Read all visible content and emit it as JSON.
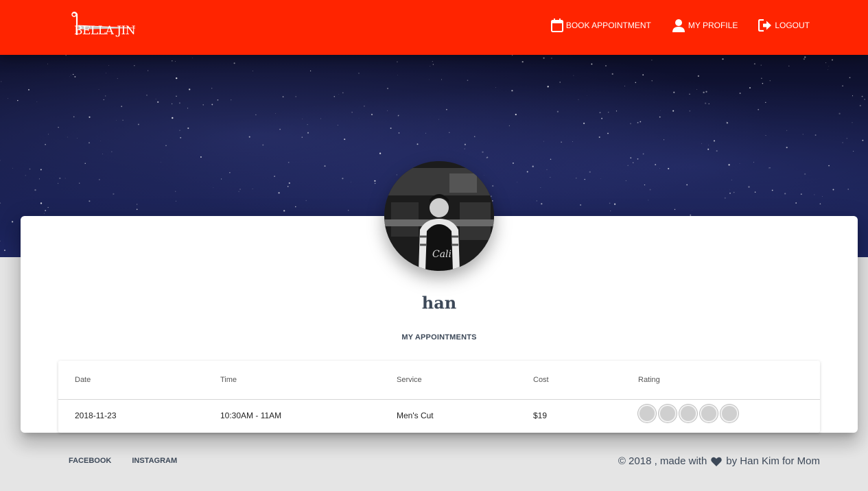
{
  "brand": {
    "logo_text": "BELLA JIN"
  },
  "nav": {
    "book": {
      "label": "BOOK APPOINTMENT",
      "icon": "calendar-icon"
    },
    "profile": {
      "label": "MY PROFILE",
      "icon": "user-icon"
    },
    "logout": {
      "label": "LOGOUT",
      "icon": "logout-icon"
    }
  },
  "profile": {
    "username": "han",
    "section_title": "MY APPOINTMENTS"
  },
  "table": {
    "headers": [
      "Date",
      "Time",
      "Service",
      "Cost",
      "Rating"
    ],
    "rows": [
      {
        "date": "2018-11-23",
        "time": "10:30AM - 11AM",
        "service": "Men's Cut",
        "cost": "$19",
        "rating": 0,
        "rating_max": 5
      }
    ]
  },
  "footer": {
    "links": [
      "FACEBOOK",
      "INSTAGRAM"
    ],
    "copyright_prefix": "© 2018 , made with",
    "copyright_suffix": "by Han Kim for Mom"
  },
  "colors": {
    "navbar": "#ff2400",
    "text": "#3c4858",
    "rating_empty": "#cfcfcf"
  }
}
